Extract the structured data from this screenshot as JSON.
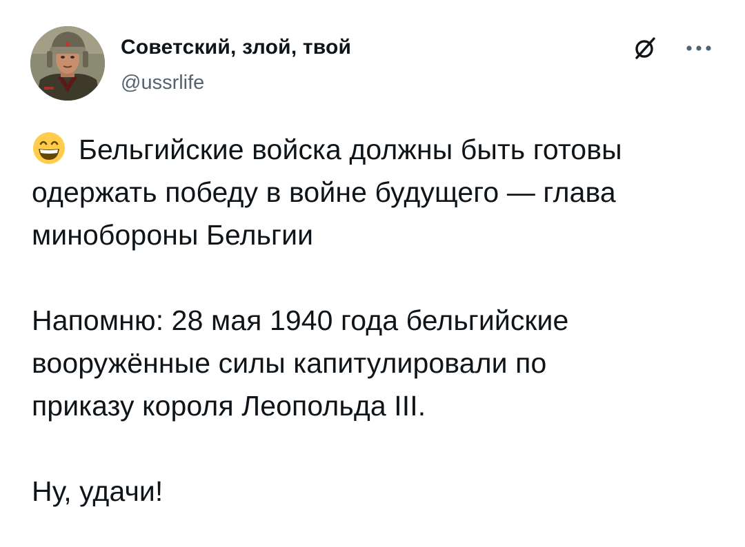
{
  "author": {
    "display_name": "Советский, злой, твой",
    "handle": "@ussrlife",
    "avatar_icon": "soldier-portrait-avatar"
  },
  "actions": {
    "grok_icon": "grok-slash-icon",
    "more_icon": "more-dots-icon"
  },
  "tweet": {
    "emoji_icon": "grinning-face-emoji",
    "line1": "Бельгийские войска должны быть готовы",
    "line2": "одержать победу в войне будущего — глава",
    "line3": "минобороны Бельгии",
    "line4": "Напомню: 28 мая 1940 года бельгийские",
    "line5": "вооружённые силы капитулировали по",
    "line6": "приказу короля Леопольда III.",
    "line7": "Ну, удачи!"
  },
  "colors": {
    "text_primary": "#0f1419",
    "text_secondary": "#536471",
    "emoji_yellow": "#ffcc4d"
  }
}
